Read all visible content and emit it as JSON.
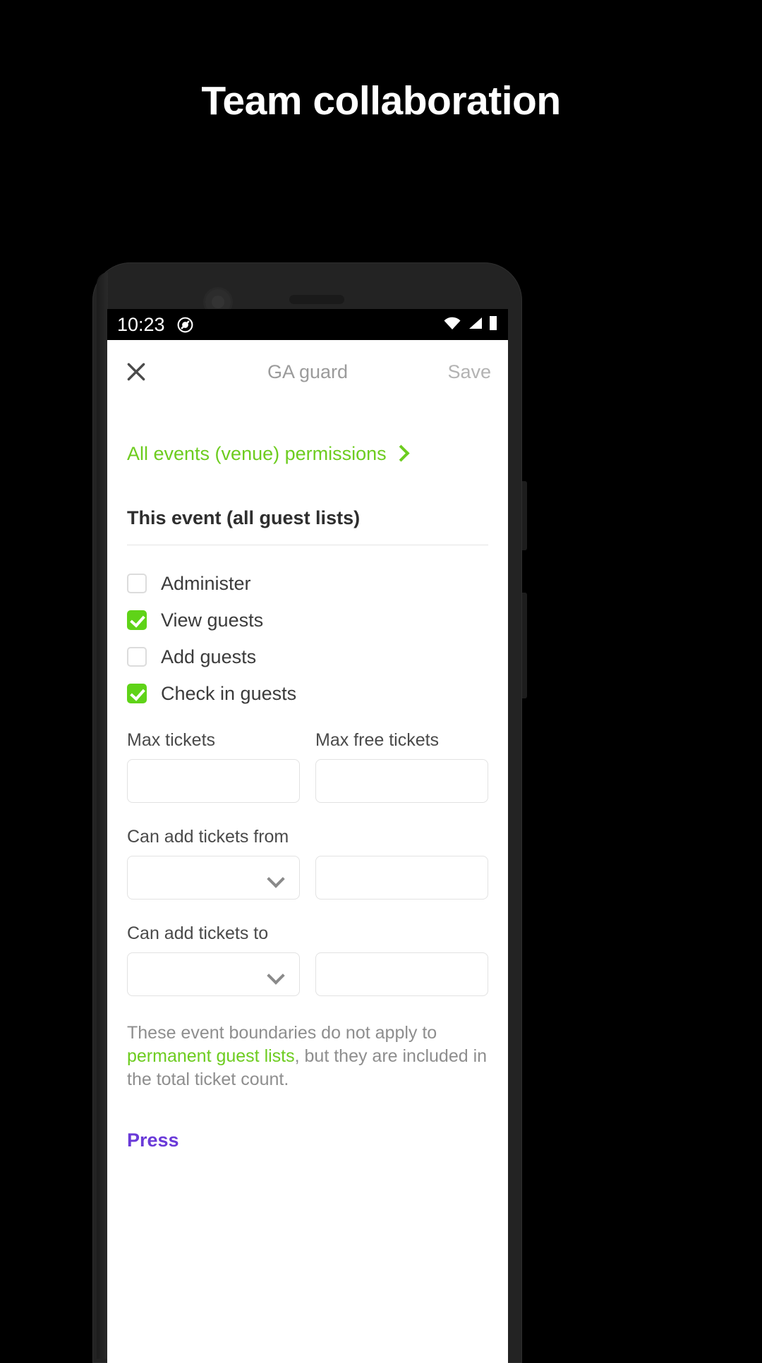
{
  "promo": {
    "title": "Team collaboration"
  },
  "status_bar": {
    "time": "10:23",
    "left_icon": "do-not-disturb-icon",
    "right_icons": [
      "wifi-icon",
      "cellular-signal-icon",
      "battery-icon"
    ]
  },
  "header": {
    "close_icon": "close-icon",
    "title": "GA guard",
    "save_label": "Save"
  },
  "content": {
    "venue_link": {
      "label": "All events (venue) permissions",
      "chevron_icon": "chevron-right-icon"
    },
    "section_title": "This event (all guest lists)",
    "permissions": [
      {
        "label": "Administer",
        "checked": false
      },
      {
        "label": "View guests",
        "checked": true
      },
      {
        "label": "Add guests",
        "checked": false
      },
      {
        "label": "Check in guests",
        "checked": true
      }
    ],
    "fields": {
      "max_tickets": {
        "label": "Max tickets",
        "value": "",
        "type": "text"
      },
      "max_free_tickets": {
        "label": "Max free tickets",
        "value": "",
        "type": "text"
      },
      "can_add_from": {
        "label": "Can add tickets from",
        "value": "",
        "type": "select"
      },
      "can_add_from_time": {
        "label": "",
        "value": "",
        "type": "text"
      },
      "can_add_to": {
        "label": "Can add tickets to",
        "value": "",
        "type": "select"
      },
      "can_add_to_time": {
        "label": "",
        "value": "",
        "type": "text"
      }
    },
    "note": {
      "part1": "These event boundaries do not apply to ",
      "link1": "permanent guest lists",
      "part2": ", but they are included in the total ticket count."
    },
    "press_link": "Press"
  },
  "colors": {
    "accent_green": "#6dcc1f",
    "checkbox_green": "#5fd318",
    "press_purple": "#6a3ad8",
    "title_gray": "#9b9b9b",
    "background": "#000000"
  }
}
